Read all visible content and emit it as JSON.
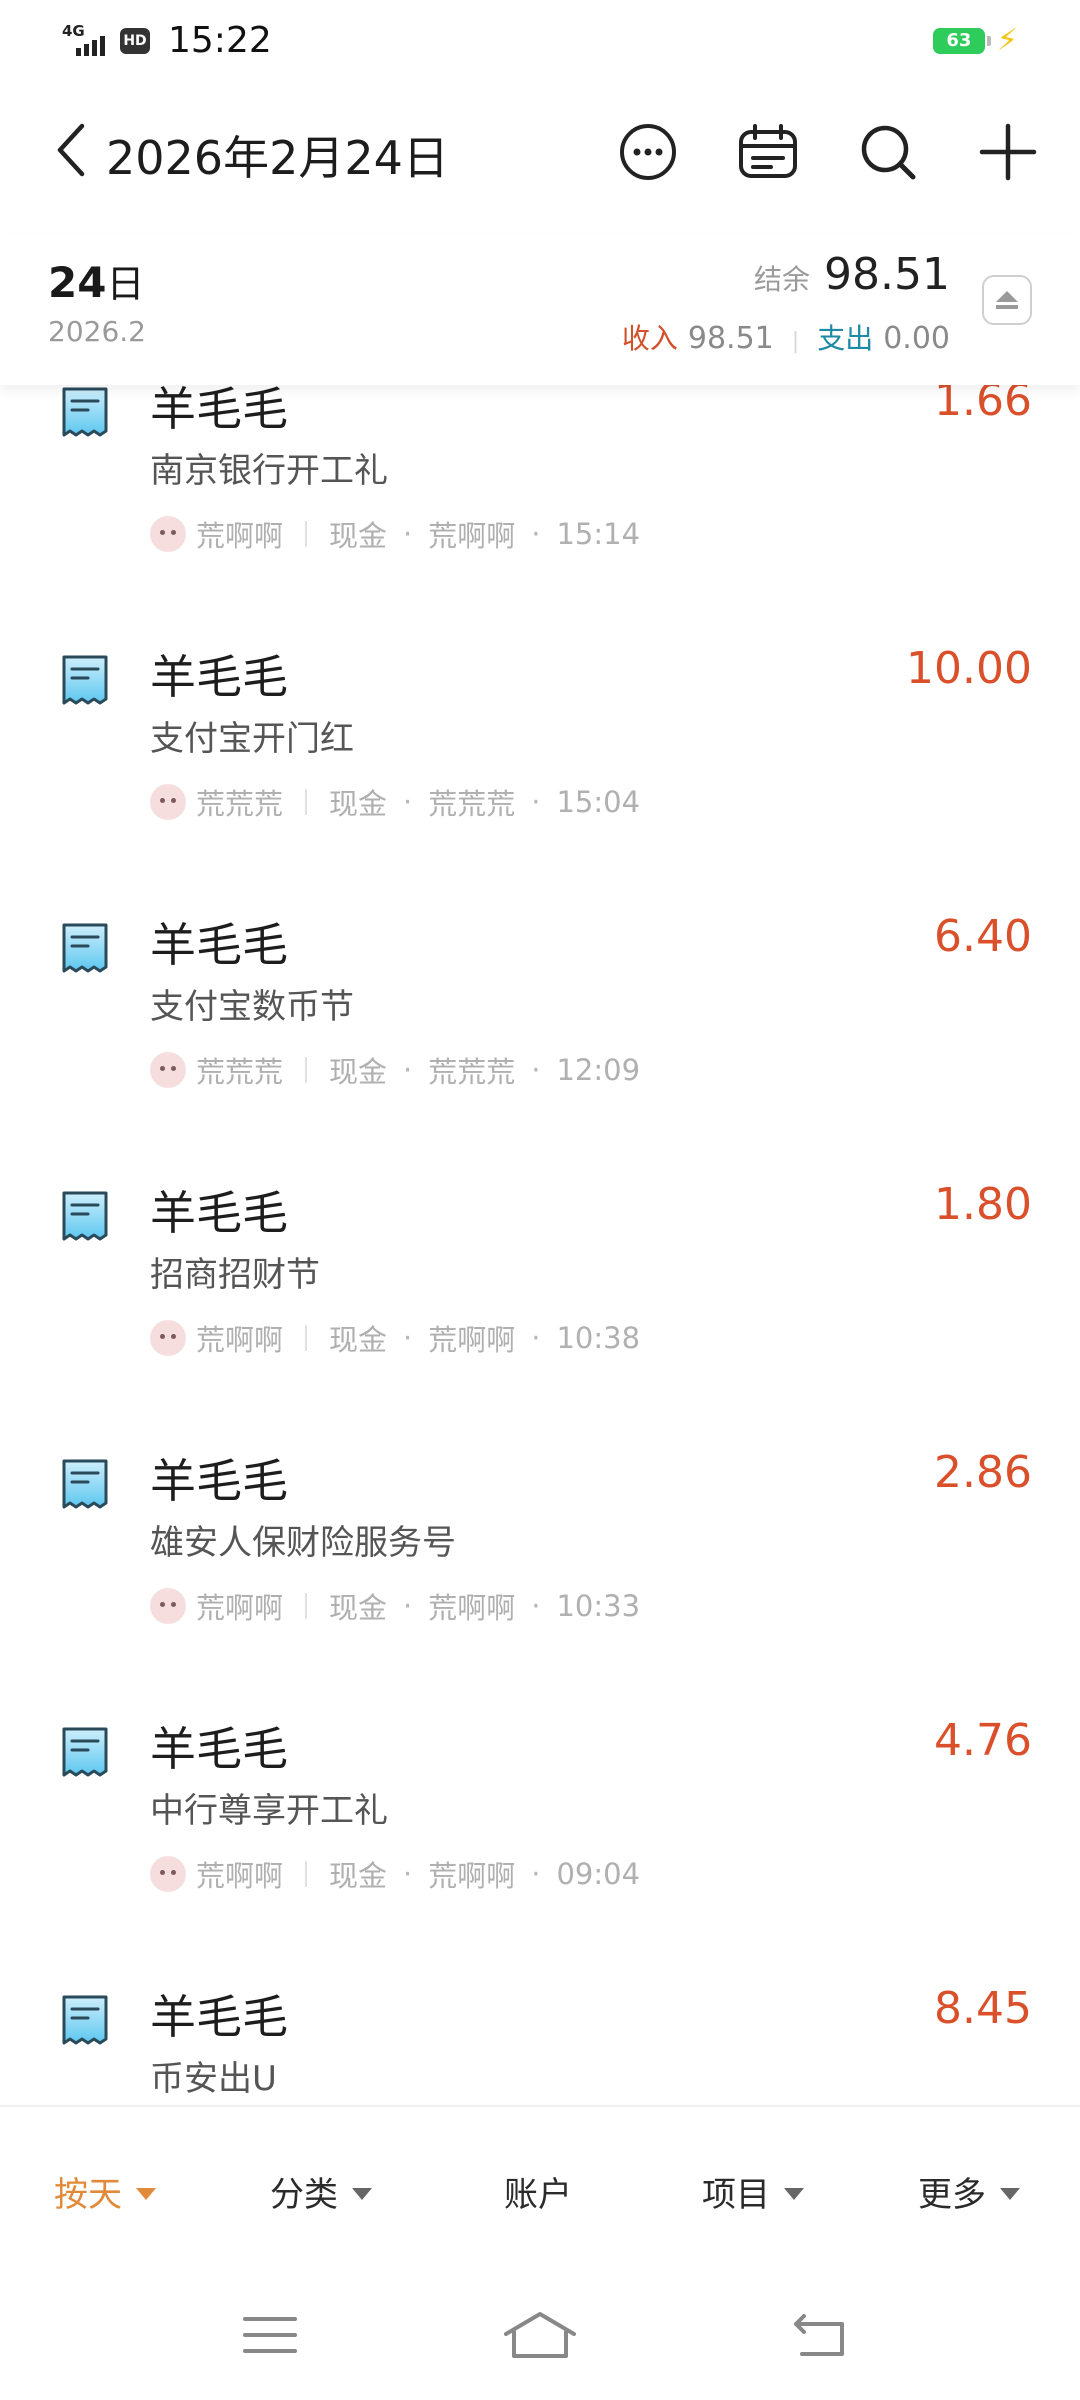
{
  "status_bar": {
    "network": "4G",
    "hd": "HD",
    "time": "15:22",
    "battery": "63"
  },
  "header": {
    "title": "2026年2月24日",
    "icons": [
      "back-icon",
      "more-icon",
      "calendar-icon",
      "search-icon",
      "add-icon"
    ]
  },
  "summary": {
    "day_number": "24",
    "day_suffix": "日",
    "month": "2026.2",
    "balance_label": "结余",
    "balance_value": "98.51",
    "income_label": "收入",
    "income_value": "98.51",
    "expense_label": "支出",
    "expense_value": "0.00"
  },
  "entries": [
    {
      "name": "羊毛毛",
      "amount": "1.66",
      "desc": "南京银行开工礼",
      "member": "荒啊啊",
      "account": "现金",
      "book": "荒啊啊",
      "time": "15:14"
    },
    {
      "name": "羊毛毛",
      "amount": "10.00",
      "desc": "支付宝开门红",
      "member": "荒荒荒",
      "account": "现金",
      "book": "荒荒荒",
      "time": "15:04"
    },
    {
      "name": "羊毛毛",
      "amount": "6.40",
      "desc": "支付宝数币节",
      "member": "荒荒荒",
      "account": "现金",
      "book": "荒荒荒",
      "time": "12:09"
    },
    {
      "name": "羊毛毛",
      "amount": "1.80",
      "desc": "招商招财节",
      "member": "荒啊啊",
      "account": "现金",
      "book": "荒啊啊",
      "time": "10:38"
    },
    {
      "name": "羊毛毛",
      "amount": "2.86",
      "desc": "雄安人保财险服务号",
      "member": "荒啊啊",
      "account": "现金",
      "book": "荒啊啊",
      "time": "10:33"
    },
    {
      "name": "羊毛毛",
      "amount": "4.76",
      "desc": "中行尊享开工礼",
      "member": "荒啊啊",
      "account": "现金",
      "book": "荒啊啊",
      "time": "09:04"
    },
    {
      "name": "羊毛毛",
      "amount": "8.45",
      "desc": "币安出U",
      "member": "",
      "account": "",
      "book": "",
      "time": ""
    }
  ],
  "tabs": {
    "by_day": "按天",
    "category": "分类",
    "account": "账户",
    "project": "项目",
    "more": "更多"
  },
  "colors": {
    "income": "#d2502a",
    "expense": "#1d8aa6",
    "amount": "#d9502b",
    "active_tab": "#e08a3a"
  }
}
